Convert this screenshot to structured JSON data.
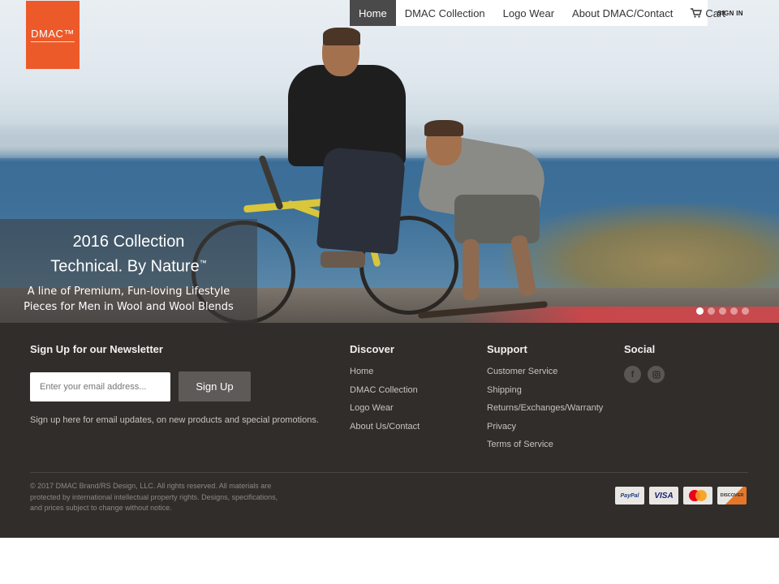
{
  "brand": {
    "logo_text": "DMAC™"
  },
  "nav": {
    "items": [
      {
        "label": "Home",
        "active": true
      },
      {
        "label": "DMAC Collection",
        "active": false
      },
      {
        "label": "Logo Wear",
        "active": false
      },
      {
        "label": "About DMAC/Contact",
        "active": false
      },
      {
        "label": "Cart",
        "active": false,
        "icon": "cart-icon"
      }
    ],
    "sign_in": "SIGN IN"
  },
  "hero": {
    "line1": "2016 Collection",
    "line2": "Technical. By Nature",
    "line2_mark": "™",
    "line3": "A line of Premium, Fun-loving Lifestyle",
    "line4": "Pieces for Men in Wool and Wool Blends",
    "slides_total": 5,
    "active_slide": 1
  },
  "footer": {
    "newsletter": {
      "heading": "Sign Up for our Newsletter",
      "email_placeholder": "Enter your email address...",
      "button": "Sign Up",
      "description": "Sign up here for email updates, on new products and special promotions."
    },
    "discover": {
      "heading": "Discover",
      "links": [
        "Home",
        "DMAC Collection",
        "Logo Wear",
        "About Us/Contact"
      ]
    },
    "support": {
      "heading": "Support",
      "links": [
        "Customer Service",
        "Shipping",
        "Returns/Exchanges/Warranty",
        "Privacy",
        "Terms of Service"
      ]
    },
    "social": {
      "heading": "Social",
      "icons": [
        "facebook-icon",
        "instagram-icon"
      ]
    },
    "copyright_lines": [
      "© 2017 DMAC Brand/RS Design, LLC. All rights reserved. All materials are",
      "protected by international intellectual property rights. Designs, specifications,",
      "and prices subject to change without notice."
    ],
    "payments": [
      {
        "name": "PayPal",
        "bg": "#e9e7e4",
        "fg": "#253b80"
      },
      {
        "name": "VISA",
        "bg": "#e9e7e4",
        "fg": "#1a1f71"
      },
      {
        "name": "",
        "bg": "#e9e7e4",
        "fg": "#eb001b"
      },
      {
        "name": "DISCOVER",
        "bg": "#e9e7e4",
        "fg": "#333333"
      }
    ]
  },
  "colors": {
    "brand_orange": "#ec5a2a",
    "footer_bg": "#302d2b",
    "nav_active_bg": "#4a4a4a"
  }
}
